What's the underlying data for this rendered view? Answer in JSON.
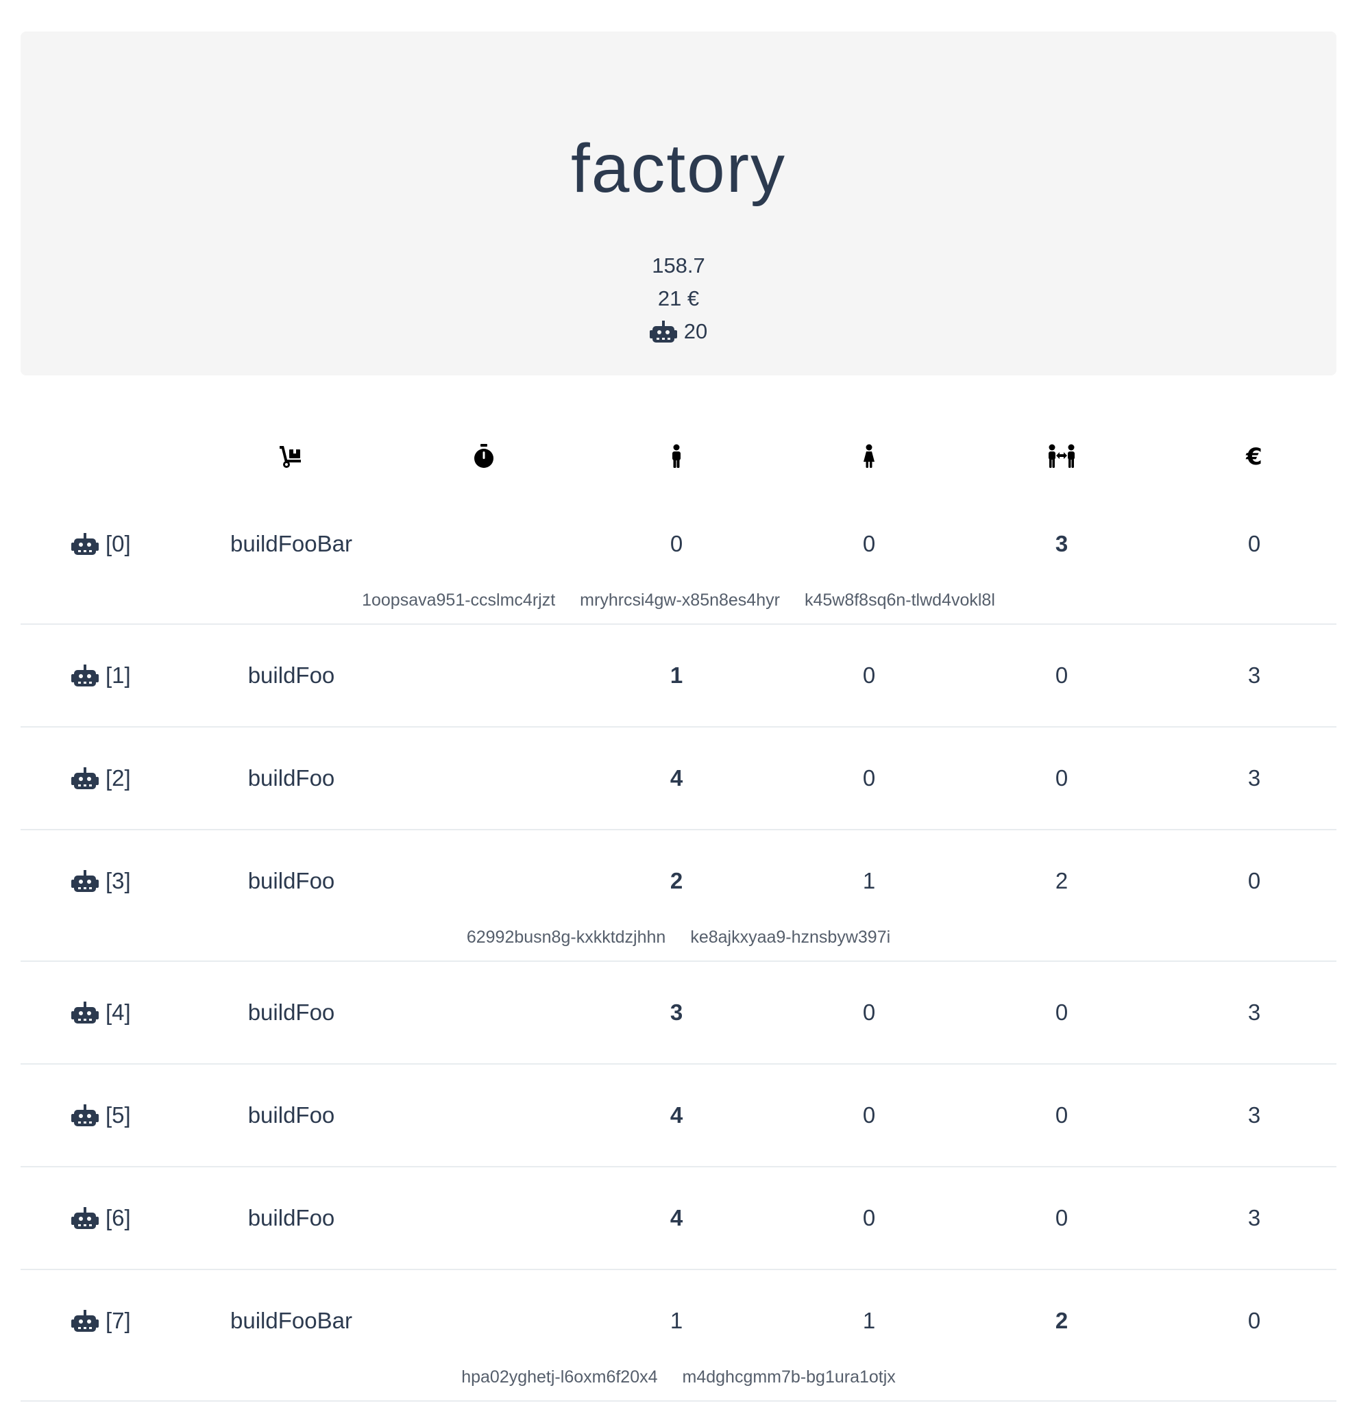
{
  "title": "factory",
  "stats": {
    "time": "158.7",
    "money": "21 €",
    "robot_count": "20"
  },
  "columns": [
    {
      "icon": "dolly-icon"
    },
    {
      "icon": "stopwatch-icon"
    },
    {
      "icon": "male-icon"
    },
    {
      "icon": "female-icon"
    },
    {
      "icon": "people-arrows-icon"
    },
    {
      "icon": "euro-icon"
    }
  ],
  "rows": [
    {
      "label": "[0]",
      "activity": "buildFooBar",
      "foo": "0",
      "bar": "0",
      "foobar": "3",
      "euro": "0",
      "bold": "foobar",
      "ids": [
        "1oopsava951-ccslmc4rjzt",
        "mryhrcsi4gw-x85n8es4hyr",
        "k45w8f8sq6n-tlwd4vokl8l"
      ]
    },
    {
      "label": "[1]",
      "activity": "buildFoo",
      "foo": "1",
      "bar": "0",
      "foobar": "0",
      "euro": "3",
      "bold": "foo",
      "ids": []
    },
    {
      "label": "[2]",
      "activity": "buildFoo",
      "foo": "4",
      "bar": "0",
      "foobar": "0",
      "euro": "3",
      "bold": "foo",
      "ids": []
    },
    {
      "label": "[3]",
      "activity": "buildFoo",
      "foo": "2",
      "bar": "1",
      "foobar": "2",
      "euro": "0",
      "bold": "foo",
      "ids": [
        "62992busn8g-kxkktdzjhhn",
        "ke8ajkxyaa9-hznsbyw397i"
      ]
    },
    {
      "label": "[4]",
      "activity": "buildFoo",
      "foo": "3",
      "bar": "0",
      "foobar": "0",
      "euro": "3",
      "bold": "foo",
      "ids": []
    },
    {
      "label": "[5]",
      "activity": "buildFoo",
      "foo": "4",
      "bar": "0",
      "foobar": "0",
      "euro": "3",
      "bold": "foo",
      "ids": []
    },
    {
      "label": "[6]",
      "activity": "buildFoo",
      "foo": "4",
      "bar": "0",
      "foobar": "0",
      "euro": "3",
      "bold": "foo",
      "ids": []
    },
    {
      "label": "[7]",
      "activity": "buildFooBar",
      "foo": "1",
      "bar": "1",
      "foobar": "2",
      "euro": "0",
      "bold": "foobar",
      "ids": [
        "hpa02yghetj-l6oxm6f20x4",
        "m4dghcgmm7b-bg1ura1otjx"
      ]
    }
  ]
}
